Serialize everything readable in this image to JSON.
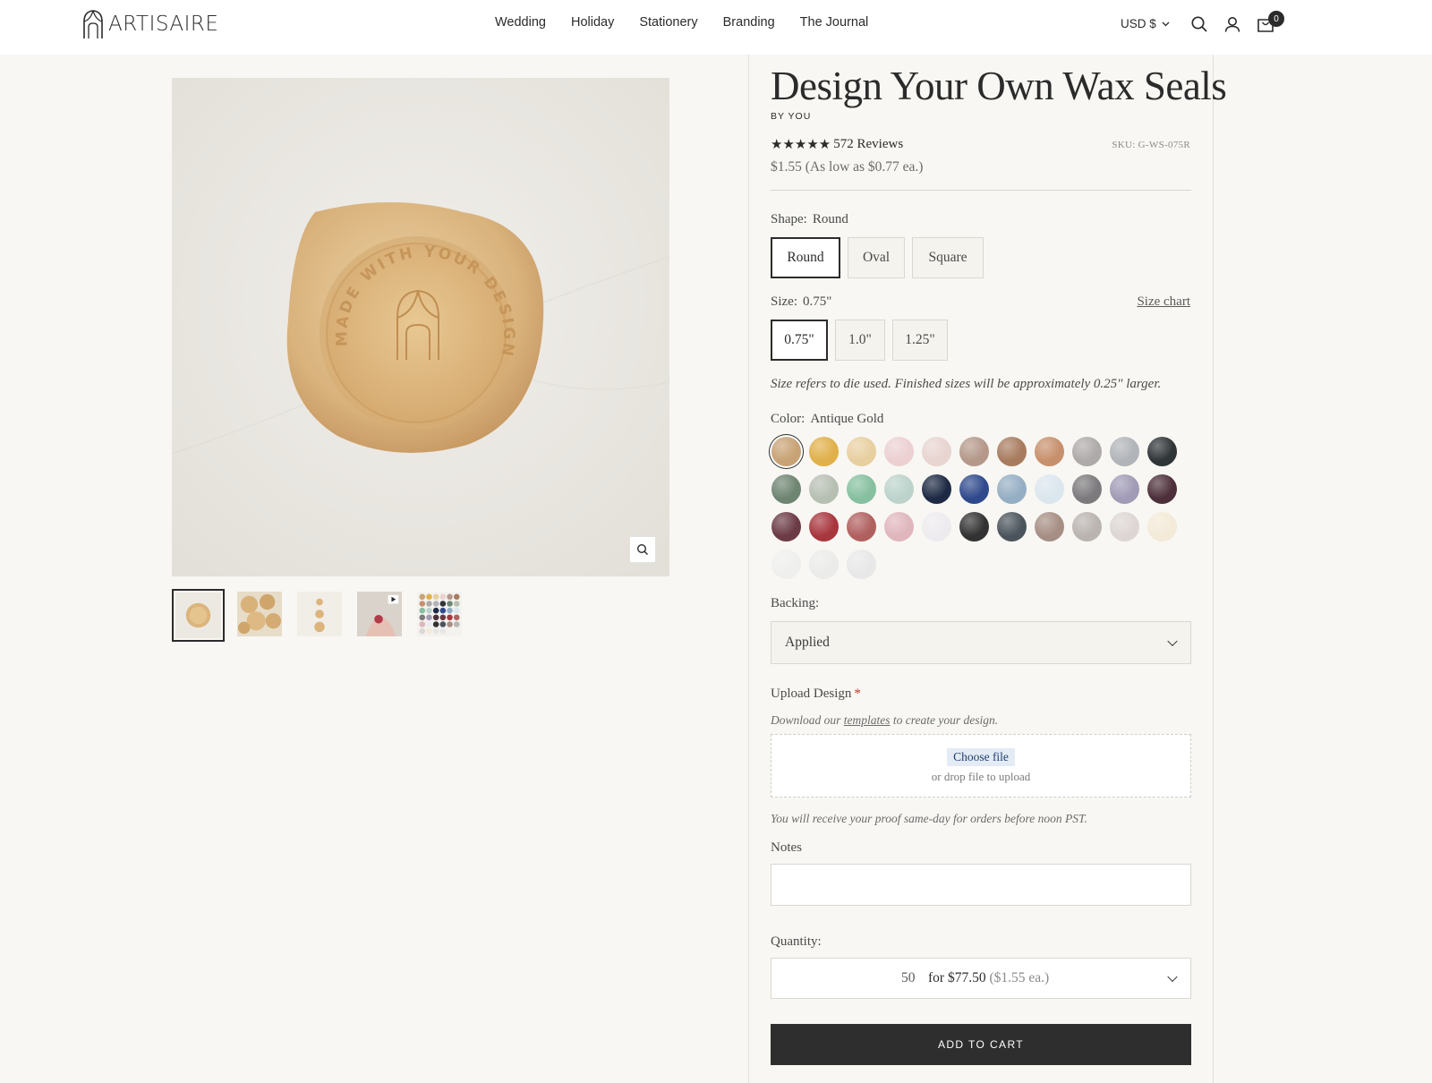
{
  "header": {
    "logo_text": "ARTISAIRE",
    "nav": [
      "Wedding",
      "Holiday",
      "Stationery",
      "Branding",
      "The Journal"
    ],
    "currency": "USD $",
    "cart_count": "0"
  },
  "gallery": {
    "seal_text": "MADE WITH YOUR DESIGN",
    "thumbnails": [
      "single-seal",
      "seal-pile",
      "three-seals",
      "video-hands",
      "color-grid"
    ]
  },
  "product": {
    "title": "Design Your Own Wax Seals",
    "by": "BY YOU",
    "stars": "★★★★★",
    "reviews": "572 Reviews",
    "sku": "SKU: G-WS-075R",
    "price": "$1.55 (As low as $0.77 ea.)"
  },
  "shape": {
    "label": "Shape:",
    "selected": "Round",
    "options": [
      "Round",
      "Oval",
      "Square"
    ]
  },
  "size": {
    "label": "Size:",
    "selected": "0.75\"",
    "options": [
      "0.75\"",
      "1.0\"",
      "1.25\""
    ],
    "chart_link": "Size chart",
    "note": "Size refers to die used. Finished sizes will be approximately 0.25\" larger."
  },
  "color": {
    "label": "Color:",
    "selected": "Antique Gold",
    "swatches": [
      "#c8a274",
      "#e0b04a",
      "#e8cfa0",
      "#ecd0d2",
      "#e8d4d0",
      "#b5988a",
      "#a87b5e",
      "#c7906c",
      "#aeaaa9",
      "#b1b4b8",
      "#2f3437",
      "#6e8571",
      "#b7bfb3",
      "#86c0a0",
      "#bcd3cc",
      "#1e2a45",
      "#2f4a8c",
      "#95aec4",
      "#dbe6ee",
      "#7c7a7c",
      "#a19bb6",
      "#4d2f3a",
      "#6b3a45",
      "#a8363d",
      "#b0605f",
      "#e0b6bd",
      "#eeebee",
      "#323232",
      "#4b545c",
      "#a68e84",
      "#bab4b0",
      "#ddd6d4",
      "#f3ead8",
      "#efefee",
      "#ebebea",
      "#e8e8e8"
    ]
  },
  "backing": {
    "label": "Backing:",
    "value": "Applied"
  },
  "upload": {
    "label": "Upload Design",
    "required_mark": "*",
    "hint_prefix": "Download our",
    "hint_link": "templates",
    "hint_suffix": "to create your design.",
    "choose_label": "Choose file",
    "drop_label": "or drop file to upload",
    "proof_note": "You will receive your proof same-day for orders before noon PST."
  },
  "notes": {
    "label": "Notes"
  },
  "quantity": {
    "label": "Quantity:",
    "value": "50",
    "for_text": "for $77.50",
    "each_text": "($1.55 ea.)"
  },
  "add_to_cart": "ADD TO CART"
}
